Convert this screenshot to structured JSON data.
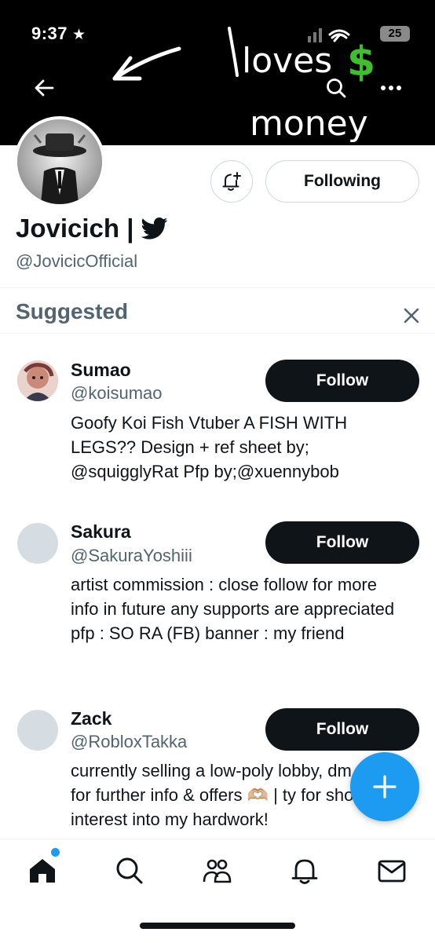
{
  "status_bar": {
    "time": "9:37",
    "battery": "25"
  },
  "banner": {
    "text_line1": "loves",
    "text_line2": "money",
    "dollar": "$"
  },
  "profile": {
    "display_name": "Jovicich |",
    "handle": "@JovicicOfficial",
    "following_label": "Following"
  },
  "suggested": {
    "title": "Suggested",
    "items": [
      {
        "name": "Sumao",
        "handle": "@koisumao",
        "bio": "Goofy Koi Fish Vtuber A FISH WITH LEGS?? Design + ref sheet by; @squigglyRat Pfp by;@xuennybob",
        "follow_label": "Follow"
      },
      {
        "name": "Sakura",
        "handle": "@SakuraYoshiii",
        "bio": "artist commission : close follow for more info in future any supports are appreciated pfp : SO RA (FB) banner : my friend",
        "follow_label": "Follow"
      },
      {
        "name": "Zack",
        "handle": "@RobloxTakka",
        "bio": "currently selling a low-poly lobby, dm me for further info & offers 🫶🏼 | ty for showing interest into my hardwork!",
        "follow_label": "Follow"
      }
    ]
  },
  "tabs": [
    "home-icon",
    "search-icon",
    "communities-icon",
    "notifications-icon",
    "messages-icon"
  ],
  "colors": {
    "accent": "#1d9bf0",
    "text": "#0f1419",
    "secondary": "#536471"
  }
}
